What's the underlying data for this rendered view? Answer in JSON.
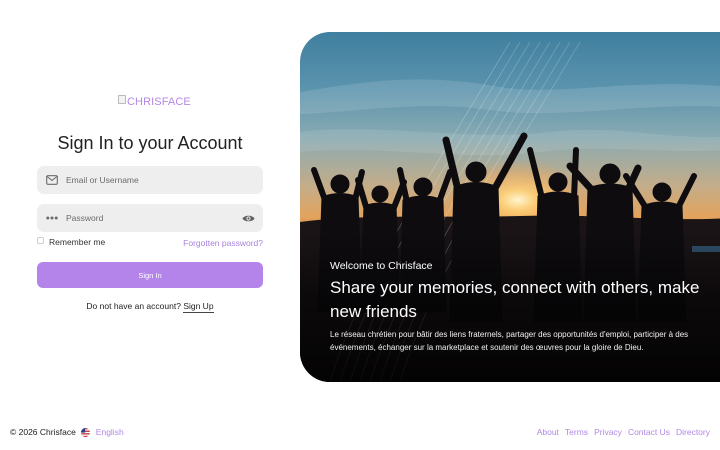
{
  "logo": {
    "alt": "CHRISFACE"
  },
  "form": {
    "title": "Sign In to your Account",
    "email_placeholder": "Email or Username",
    "password_placeholder": "Password",
    "remember_label": "Remember me",
    "forgot_label": "Forgotten password?",
    "signin_label": "Sign In",
    "no_account_text": "Do not have an account?",
    "signup_label": "Sign Up"
  },
  "hero": {
    "welcome": "Welcome to Chrisface",
    "headline": "Share your memories, connect with others, make new friends",
    "description": "Le réseau chrétien pour bâtir des liens fraternels, partager des opportunités d'emploi, participer à des événements, échanger sur la marketplace et soutenir des œuvres pour la gloire de Dieu.",
    "image": "silhouettes-of-people-raising-hands-at-sunset"
  },
  "footer": {
    "copyright": "© 2026 Chrisface",
    "language": "English",
    "links": [
      "About",
      "Terms",
      "Privacy",
      "Contact Us",
      "Directory"
    ]
  },
  "icons": {
    "email": "mail-icon",
    "password": "password-dots-icon",
    "toggle": "eye-icon",
    "flag": "us-flag-icon"
  },
  "colors": {
    "accent": "#b584ea",
    "link": "#a982e0",
    "field_bg": "#eeeeee",
    "text": "#222222"
  }
}
